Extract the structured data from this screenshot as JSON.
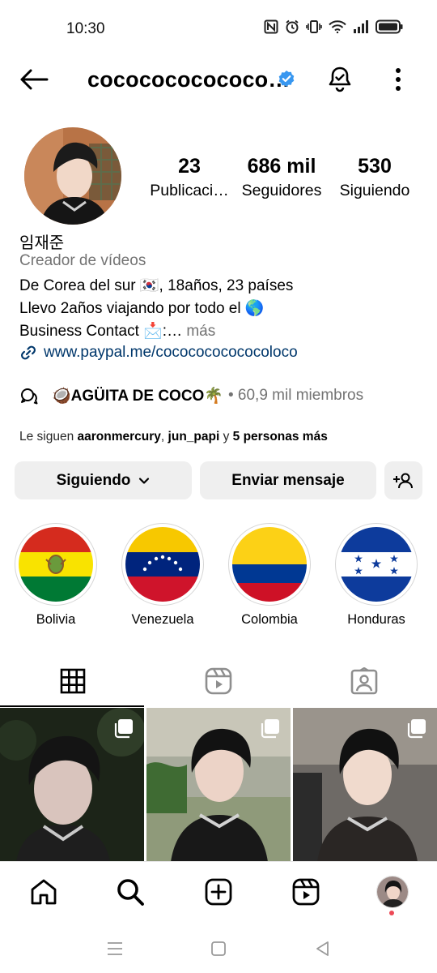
{
  "status_bar": {
    "time": "10:30",
    "icons": [
      "nfc-icon",
      "alarm-icon",
      "vibrate-icon",
      "wifi-icon",
      "signal-icon",
      "battery-icon"
    ]
  },
  "header": {
    "username": "cococococococo…",
    "verified": true,
    "back_icon": "arrow-left-icon",
    "bell_icon": "bell-check-icon",
    "more_icon": "more-vertical-icon"
  },
  "profile": {
    "stats": [
      {
        "value": "23",
        "label": "Publicaci…"
      },
      {
        "value": "686 mil",
        "label": "Seguidores"
      },
      {
        "value": "530",
        "label": "Siguiendo"
      }
    ],
    "display_name": "임재준",
    "category": "Creador de vídeos",
    "bio_line1": "De Corea del sur 🇰🇷, 18años, 23 países",
    "bio_line2": "Llevo 2años viajando por todo el 🌎",
    "bio_line3": "Business Contact 📩:…",
    "bio_more": " más",
    "link": "www.paypal.me/cococococococoloco",
    "channel_name": "🥥AGÜITA DE COCO🌴",
    "channel_members": "• 60,9 mil miembros",
    "followed_by_prefix": "Le siguen ",
    "followed_by_user1": "aaronmercury",
    "followed_by_sep1": ", ",
    "followed_by_user2": "jun_papi",
    "followed_by_sep2": " y ",
    "followed_by_rest": "5 personas más"
  },
  "actions": {
    "following_label": "Siguiendo",
    "message_label": "Enviar mensaje"
  },
  "highlights": [
    {
      "label": "Bolivia"
    },
    {
      "label": "Venezuela"
    },
    {
      "label": "Colombia"
    },
    {
      "label": "Honduras"
    }
  ],
  "tabs": [
    {
      "icon": "grid-icon",
      "active": true
    },
    {
      "icon": "reels-icon",
      "active": false
    },
    {
      "icon": "tagged-icon",
      "active": false
    }
  ],
  "bottom_nav": [
    "home-icon",
    "search-icon",
    "create-icon",
    "reels-icon",
    "profile-avatar"
  ],
  "colors": {
    "verified_blue": "#3897f0",
    "link_blue": "#00376b",
    "secondary_text": "#737373",
    "button_bg": "#efefef",
    "notification_dot": "#ed4956"
  }
}
